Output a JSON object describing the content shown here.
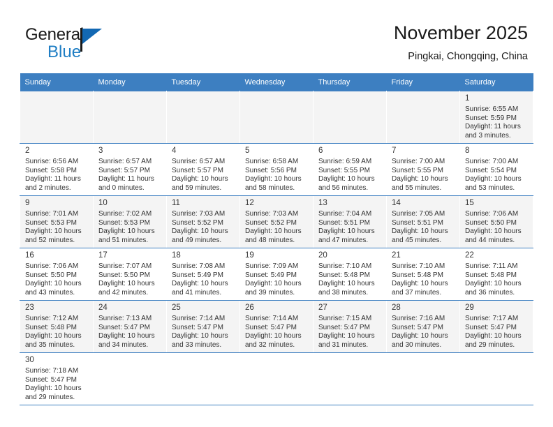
{
  "brand": {
    "name_primary": "General",
    "name_secondary": "Blue",
    "accent_color": "#1f7ec4",
    "flag_color": "#1268b3"
  },
  "header": {
    "title": "November 2025",
    "subtitle": "Pingkai, Chongqing, China"
  },
  "calendar": {
    "header_bg": "#3d7fc1",
    "weekday_headers": [
      "Sunday",
      "Monday",
      "Tuesday",
      "Wednesday",
      "Thursday",
      "Friday",
      "Saturday"
    ],
    "labels": {
      "sunrise": "Sunrise:",
      "sunset": "Sunset:",
      "daylight": "Daylight:"
    },
    "weeks": [
      [
        null,
        null,
        null,
        null,
        null,
        null,
        {
          "day": "1",
          "sunrise": "Sunrise: 6:55 AM",
          "sunset": "Sunset: 5:59 PM",
          "daylight_line1": "Daylight: 11 hours",
          "daylight_line2": "and 3 minutes."
        }
      ],
      [
        {
          "day": "2",
          "sunrise": "Sunrise: 6:56 AM",
          "sunset": "Sunset: 5:58 PM",
          "daylight_line1": "Daylight: 11 hours",
          "daylight_line2": "and 2 minutes."
        },
        {
          "day": "3",
          "sunrise": "Sunrise: 6:57 AM",
          "sunset": "Sunset: 5:57 PM",
          "daylight_line1": "Daylight: 11 hours",
          "daylight_line2": "and 0 minutes."
        },
        {
          "day": "4",
          "sunrise": "Sunrise: 6:57 AM",
          "sunset": "Sunset: 5:57 PM",
          "daylight_line1": "Daylight: 10 hours",
          "daylight_line2": "and 59 minutes."
        },
        {
          "day": "5",
          "sunrise": "Sunrise: 6:58 AM",
          "sunset": "Sunset: 5:56 PM",
          "daylight_line1": "Daylight: 10 hours",
          "daylight_line2": "and 58 minutes."
        },
        {
          "day": "6",
          "sunrise": "Sunrise: 6:59 AM",
          "sunset": "Sunset: 5:55 PM",
          "daylight_line1": "Daylight: 10 hours",
          "daylight_line2": "and 56 minutes."
        },
        {
          "day": "7",
          "sunrise": "Sunrise: 7:00 AM",
          "sunset": "Sunset: 5:55 PM",
          "daylight_line1": "Daylight: 10 hours",
          "daylight_line2": "and 55 minutes."
        },
        {
          "day": "8",
          "sunrise": "Sunrise: 7:00 AM",
          "sunset": "Sunset: 5:54 PM",
          "daylight_line1": "Daylight: 10 hours",
          "daylight_line2": "and 53 minutes."
        }
      ],
      [
        {
          "day": "9",
          "sunrise": "Sunrise: 7:01 AM",
          "sunset": "Sunset: 5:53 PM",
          "daylight_line1": "Daylight: 10 hours",
          "daylight_line2": "and 52 minutes."
        },
        {
          "day": "10",
          "sunrise": "Sunrise: 7:02 AM",
          "sunset": "Sunset: 5:53 PM",
          "daylight_line1": "Daylight: 10 hours",
          "daylight_line2": "and 51 minutes."
        },
        {
          "day": "11",
          "sunrise": "Sunrise: 7:03 AM",
          "sunset": "Sunset: 5:52 PM",
          "daylight_line1": "Daylight: 10 hours",
          "daylight_line2": "and 49 minutes."
        },
        {
          "day": "12",
          "sunrise": "Sunrise: 7:03 AM",
          "sunset": "Sunset: 5:52 PM",
          "daylight_line1": "Daylight: 10 hours",
          "daylight_line2": "and 48 minutes."
        },
        {
          "day": "13",
          "sunrise": "Sunrise: 7:04 AM",
          "sunset": "Sunset: 5:51 PM",
          "daylight_line1": "Daylight: 10 hours",
          "daylight_line2": "and 47 minutes."
        },
        {
          "day": "14",
          "sunrise": "Sunrise: 7:05 AM",
          "sunset": "Sunset: 5:51 PM",
          "daylight_line1": "Daylight: 10 hours",
          "daylight_line2": "and 45 minutes."
        },
        {
          "day": "15",
          "sunrise": "Sunrise: 7:06 AM",
          "sunset": "Sunset: 5:50 PM",
          "daylight_line1": "Daylight: 10 hours",
          "daylight_line2": "and 44 minutes."
        }
      ],
      [
        {
          "day": "16",
          "sunrise": "Sunrise: 7:06 AM",
          "sunset": "Sunset: 5:50 PM",
          "daylight_line1": "Daylight: 10 hours",
          "daylight_line2": "and 43 minutes."
        },
        {
          "day": "17",
          "sunrise": "Sunrise: 7:07 AM",
          "sunset": "Sunset: 5:50 PM",
          "daylight_line1": "Daylight: 10 hours",
          "daylight_line2": "and 42 minutes."
        },
        {
          "day": "18",
          "sunrise": "Sunrise: 7:08 AM",
          "sunset": "Sunset: 5:49 PM",
          "daylight_line1": "Daylight: 10 hours",
          "daylight_line2": "and 41 minutes."
        },
        {
          "day": "19",
          "sunrise": "Sunrise: 7:09 AM",
          "sunset": "Sunset: 5:49 PM",
          "daylight_line1": "Daylight: 10 hours",
          "daylight_line2": "and 39 minutes."
        },
        {
          "day": "20",
          "sunrise": "Sunrise: 7:10 AM",
          "sunset": "Sunset: 5:48 PM",
          "daylight_line1": "Daylight: 10 hours",
          "daylight_line2": "and 38 minutes."
        },
        {
          "day": "21",
          "sunrise": "Sunrise: 7:10 AM",
          "sunset": "Sunset: 5:48 PM",
          "daylight_line1": "Daylight: 10 hours",
          "daylight_line2": "and 37 minutes."
        },
        {
          "day": "22",
          "sunrise": "Sunrise: 7:11 AM",
          "sunset": "Sunset: 5:48 PM",
          "daylight_line1": "Daylight: 10 hours",
          "daylight_line2": "and 36 minutes."
        }
      ],
      [
        {
          "day": "23",
          "sunrise": "Sunrise: 7:12 AM",
          "sunset": "Sunset: 5:48 PM",
          "daylight_line1": "Daylight: 10 hours",
          "daylight_line2": "and 35 minutes."
        },
        {
          "day": "24",
          "sunrise": "Sunrise: 7:13 AM",
          "sunset": "Sunset: 5:47 PM",
          "daylight_line1": "Daylight: 10 hours",
          "daylight_line2": "and 34 minutes."
        },
        {
          "day": "25",
          "sunrise": "Sunrise: 7:14 AM",
          "sunset": "Sunset: 5:47 PM",
          "daylight_line1": "Daylight: 10 hours",
          "daylight_line2": "and 33 minutes."
        },
        {
          "day": "26",
          "sunrise": "Sunrise: 7:14 AM",
          "sunset": "Sunset: 5:47 PM",
          "daylight_line1": "Daylight: 10 hours",
          "daylight_line2": "and 32 minutes."
        },
        {
          "day": "27",
          "sunrise": "Sunrise: 7:15 AM",
          "sunset": "Sunset: 5:47 PM",
          "daylight_line1": "Daylight: 10 hours",
          "daylight_line2": "and 31 minutes."
        },
        {
          "day": "28",
          "sunrise": "Sunrise: 7:16 AM",
          "sunset": "Sunset: 5:47 PM",
          "daylight_line1": "Daylight: 10 hours",
          "daylight_line2": "and 30 minutes."
        },
        {
          "day": "29",
          "sunrise": "Sunrise: 7:17 AM",
          "sunset": "Sunset: 5:47 PM",
          "daylight_line1": "Daylight: 10 hours",
          "daylight_line2": "and 29 minutes."
        }
      ],
      [
        {
          "day": "30",
          "sunrise": "Sunrise: 7:18 AM",
          "sunset": "Sunset: 5:47 PM",
          "daylight_line1": "Daylight: 10 hours",
          "daylight_line2": "and 29 minutes."
        },
        null,
        null,
        null,
        null,
        null,
        null
      ]
    ]
  }
}
